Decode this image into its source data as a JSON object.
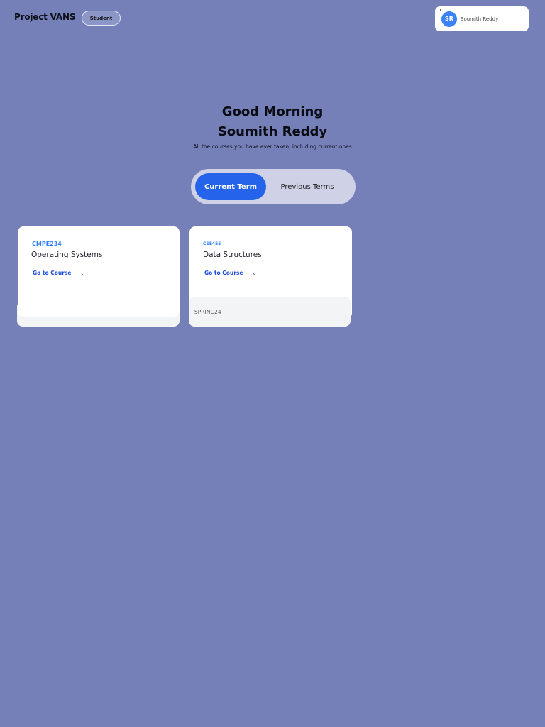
{
  "header": {
    "brand": "Project VANS",
    "role_badge": "Student",
    "user": {
      "initials": "SR",
      "name": "Soumith Reddy"
    }
  },
  "greeting": {
    "line1": "Good Morning",
    "line2": "Soumith Reddy",
    "subtitle": "All the courses you have ever taken, including current ones"
  },
  "term_toggle": {
    "current": "Current Term",
    "previous": "Previous Terms",
    "selected": "current"
  },
  "courses": [
    {
      "code": "CMPE234",
      "title": "Operating Systems",
      "link": "Go to Course",
      "term": ""
    },
    {
      "code": "CSE455",
      "title": "Data Structures",
      "link": "Go to Course",
      "term": "SPRING24"
    }
  ],
  "icons": {
    "chevron": "chevron-right-icon"
  },
  "colors": {
    "background": "#7580b8",
    "accent": "#2563eb",
    "code_blue": "#2f7ef7"
  }
}
